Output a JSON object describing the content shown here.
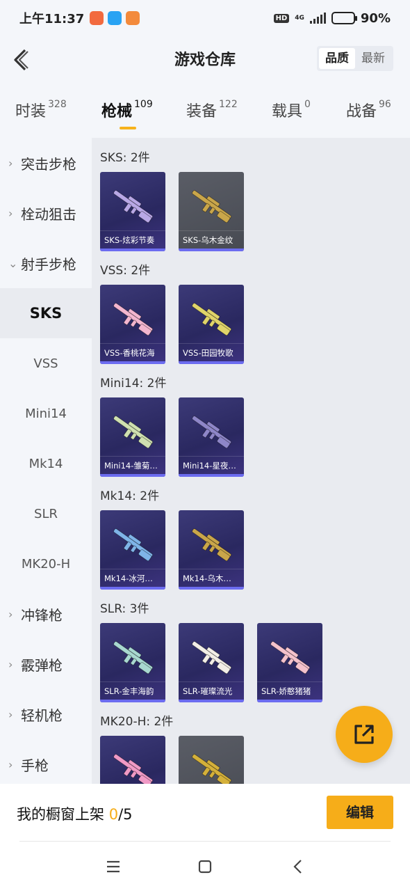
{
  "status_bar": {
    "time": "上午11:37",
    "hd": "HD",
    "network": "4G",
    "battery": "90%",
    "battery_level": 0.9,
    "app_icon_colors": [
      "#f26a3f",
      "#29a3f3",
      "#f38a3c"
    ]
  },
  "header": {
    "title": "游戏仓库",
    "sort_options": [
      "品质",
      "最新"
    ],
    "active_sort": "品质"
  },
  "tabs": [
    {
      "label": "时装",
      "count": "328"
    },
    {
      "label": "枪械",
      "count": "109",
      "active": true
    },
    {
      "label": "装备",
      "count": "122"
    },
    {
      "label": "载具",
      "count": "0"
    },
    {
      "label": "战备",
      "count": "96"
    }
  ],
  "sidebar": {
    "items": [
      {
        "label": "突击步枪",
        "type": "category",
        "expanded": false
      },
      {
        "label": "栓动狙击",
        "type": "category",
        "expanded": false
      },
      {
        "label": "射手步枪",
        "type": "category",
        "expanded": true
      },
      {
        "label": "SKS",
        "type": "sub",
        "active": true
      },
      {
        "label": "VSS",
        "type": "sub"
      },
      {
        "label": "Mini14",
        "type": "sub"
      },
      {
        "label": "Mk14",
        "type": "sub"
      },
      {
        "label": "SLR",
        "type": "sub"
      },
      {
        "label": "MK20-H",
        "type": "sub"
      },
      {
        "label": "冲锋枪",
        "type": "category",
        "expanded": false
      },
      {
        "label": "霰弹枪",
        "type": "category",
        "expanded": false
      },
      {
        "label": "轻机枪",
        "type": "category",
        "expanded": false
      },
      {
        "label": "手枪",
        "type": "category",
        "expanded": false
      }
    ]
  },
  "groups": [
    {
      "title": "SKS: 2件",
      "items": [
        {
          "label": "SKS-炫彩节奏",
          "style": "purple",
          "weapon_color": "#b9a8e6"
        },
        {
          "label": "SKS-乌木金纹",
          "style": "grey",
          "weapon_color": "#c9a64a"
        }
      ]
    },
    {
      "title": "VSS: 2件",
      "items": [
        {
          "label": "VSS-香桃花海",
          "style": "purple",
          "weapon_color": "#f3b6cf"
        },
        {
          "label": "VSS-田园牧歌",
          "style": "purple",
          "weapon_color": "#e0d46a"
        }
      ]
    },
    {
      "title": "Mini14: 2件",
      "items": [
        {
          "label": "Mini14-雏菊…",
          "style": "purple",
          "weapon_color": "#cfe0b0"
        },
        {
          "label": "Mini14-星夜…",
          "style": "purple",
          "weapon_color": "#8e86c8"
        }
      ]
    },
    {
      "title": "Mk14: 2件",
      "items": [
        {
          "label": "Mk14-冰河…",
          "style": "purple",
          "weapon_color": "#7fb4e8"
        },
        {
          "label": "Mk14-乌木…",
          "style": "purple",
          "weapon_color": "#c9a64a"
        }
      ]
    },
    {
      "title": "SLR: 3件",
      "items": [
        {
          "label": "SLR-金丰海韵",
          "style": "purple",
          "weapon_color": "#a8d8d0"
        },
        {
          "label": "SLR-璀璨流光",
          "style": "purple",
          "weapon_color": "#f2eee6"
        },
        {
          "label": "SLR-娇憨猪猪",
          "style": "purple",
          "weapon_color": "#f4c2cc"
        }
      ]
    },
    {
      "title": "MK20-H: 2件",
      "items": [
        {
          "label": "",
          "style": "purple",
          "weapon_color": "#f09ac6"
        },
        {
          "label": "",
          "style": "grey",
          "weapon_color": "#d4b03a"
        }
      ]
    }
  ],
  "bottom_bar": {
    "label": "我的橱窗上架",
    "current": "0",
    "total": "/5",
    "edit_label": "编辑"
  },
  "colors": {
    "accent": "#f6ad19",
    "card_purple": "#2a2860",
    "card_grey": "#4d5058"
  }
}
